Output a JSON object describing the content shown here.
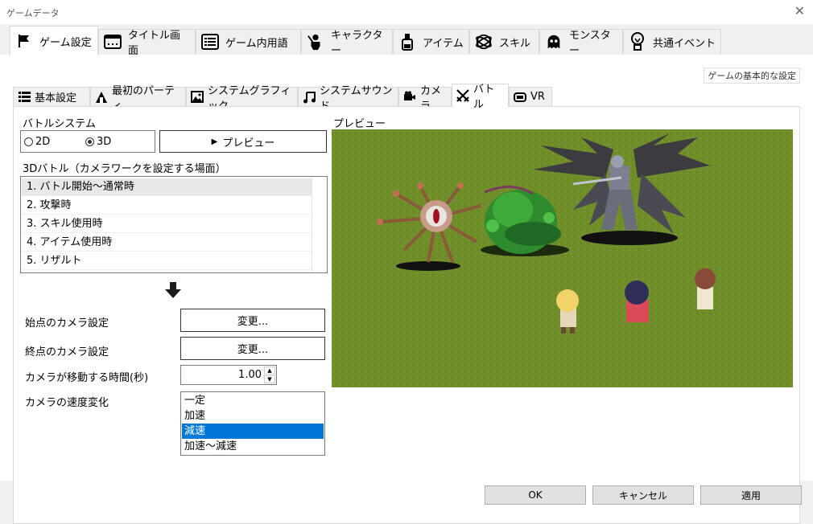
{
  "window": {
    "title": "ゲームデータ"
  },
  "main_tabs": [
    {
      "label": "ゲーム設定",
      "icon": "flag-icon"
    },
    {
      "label": "タイトル画面",
      "icon": "window-icon"
    },
    {
      "label": "ゲーム内用語",
      "icon": "list-icon"
    },
    {
      "label": "キャラクター",
      "icon": "character-icon"
    },
    {
      "label": "アイテム",
      "icon": "bottle-icon"
    },
    {
      "label": "スキル",
      "icon": "orb-icon"
    },
    {
      "label": "モンスター",
      "icon": "ghost-icon"
    },
    {
      "label": "共通イベント",
      "icon": "bulb-icon"
    }
  ],
  "pane_header": "ゲームの基本的な設定",
  "sub_tabs": [
    {
      "label": "基本設定",
      "icon": "list-icon"
    },
    {
      "label": "最初のパーティ",
      "icon": "party-icon"
    },
    {
      "label": "システムグラフィック",
      "icon": "image-icon"
    },
    {
      "label": "システムサウンド",
      "icon": "music-icon"
    },
    {
      "label": "カメラ",
      "icon": "camera-icon"
    },
    {
      "label": "バトル",
      "icon": "swords-icon"
    },
    {
      "label": "VR",
      "icon": "vr-icon"
    }
  ],
  "battle": {
    "system_label": "バトルシステム",
    "opt_2d": "2D",
    "opt_3d": "3D",
    "selected_system": "3D",
    "preview_button": "プレビュー",
    "camera_list_label": "3Dバトル（カメラワークを設定する場面）",
    "scenes": [
      "1. バトル開始～通常時",
      "2. 攻撃時",
      "3. スキル使用時",
      "4. アイテム使用時",
      "5. リザルト"
    ],
    "selected_scene": 0,
    "start_camera_label": "始点のカメラ設定",
    "end_camera_label": "終点のカメラ設定",
    "change_button": "変更...",
    "move_time_label": "カメラが移動する時間(秒)",
    "move_time_value": "1.00",
    "speed_label": "カメラの速度変化",
    "speed_options": [
      "一定",
      "加速",
      "減速",
      "加速～減速"
    ],
    "selected_speed": 2,
    "preview_label": "プレビュー"
  },
  "buttons": {
    "ok": "OK",
    "cancel": "キャンセル",
    "apply": "適用"
  },
  "colors": {
    "grass": "#6f8e2a",
    "selection": "#0078d7",
    "arrow": "#1a1a1a"
  }
}
